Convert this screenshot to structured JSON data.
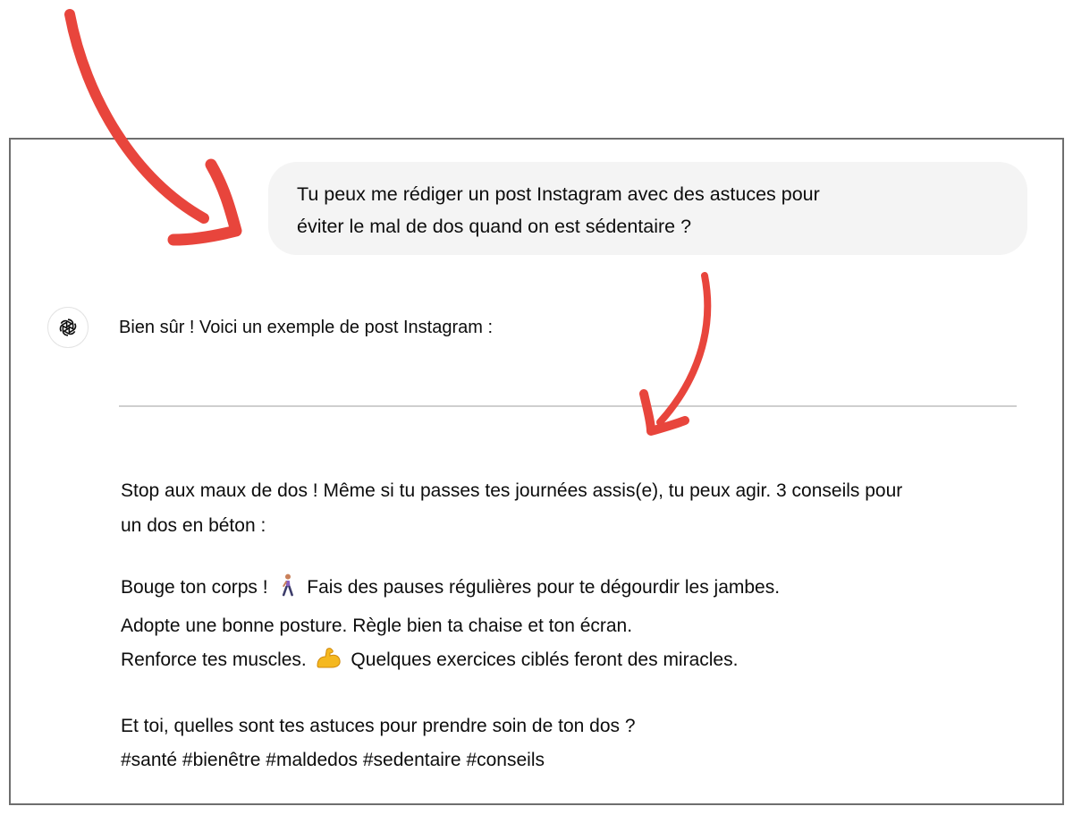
{
  "conversation": {
    "user_message": {
      "line1": "Tu peux me rédiger un post Instagram avec des astuces pour",
      "line2": "éviter le mal de dos quand on est sédentaire ?"
    },
    "assistant": {
      "avatar_icon": "openai-logo-icon",
      "intro": "Bien sûr ! Voici un exemple de post Instagram :",
      "post": {
        "intro_line1": "Stop aux maux de dos ! Même si tu passes tes journées assis(e), tu peux agir. 3 conseils pour",
        "intro_line2": "un dos en béton :",
        "tip1_start": "Bouge ton corps !",
        "tip1_emoji": "person-walking-icon",
        "tip1_end": "Fais des pauses régulières pour te dégourdir les jambes.",
        "tip2": "Adopte une bonne posture. Règle bien ta chaise et ton écran.",
        "tip3_start": "Renforce tes muscles.",
        "tip3_emoji": "flexed-biceps-icon",
        "tip3_end": "Quelques exercices ciblés feront des miracles.",
        "question": "Et toi, quelles sont tes astuces pour prendre soin de ton dos ?",
        "hashtags": "#santé #bienêtre #maldedos #sedentaire #conseils"
      }
    }
  },
  "annotations": {
    "arrow_color": "#e8453c",
    "arrows": [
      "curved-arrow-to-prompt-icon",
      "curved-arrow-to-answer-icon"
    ]
  }
}
